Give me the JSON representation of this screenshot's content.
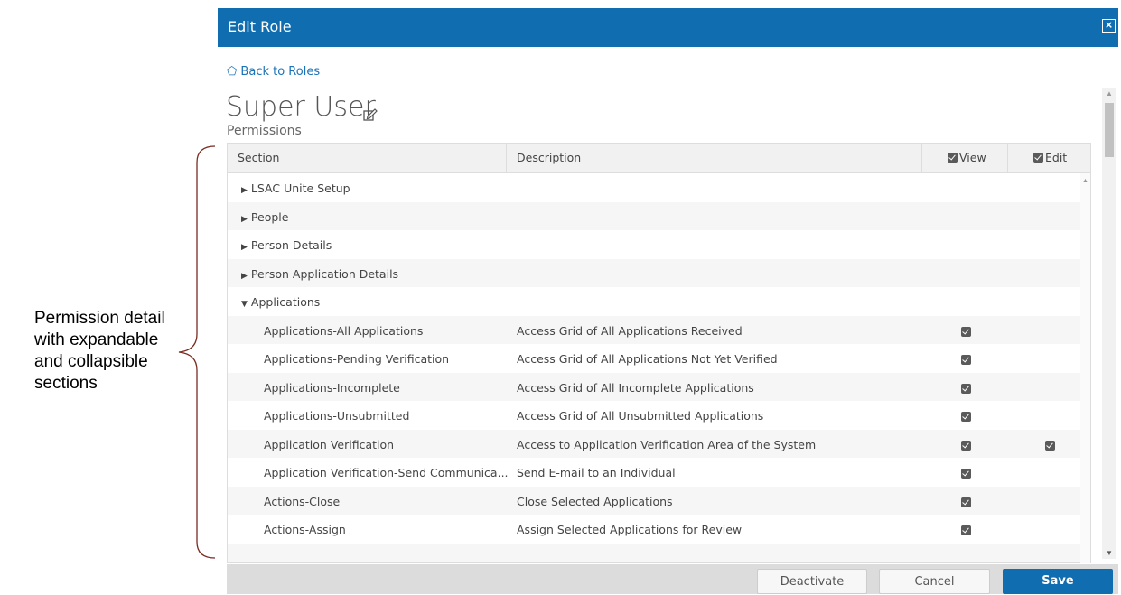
{
  "annotation": {
    "text": "Permission detail with expandable and collapsible sections"
  },
  "dialog": {
    "title": "Edit Role",
    "back_link": "⬠ Back to Roles",
    "role_name": "Super User",
    "permissions_label": "Permissions"
  },
  "grid": {
    "columns": {
      "section": "Section",
      "description": "Description",
      "view": "View",
      "edit": "Edit"
    },
    "rows": [
      {
        "section": "LSAC Unite Setup",
        "expander": "▶",
        "description": "",
        "view": false,
        "edit": false,
        "child": false
      },
      {
        "section": "People",
        "expander": "▶",
        "description": "",
        "view": false,
        "edit": false,
        "child": false
      },
      {
        "section": "Person Details",
        "expander": "▶",
        "description": "",
        "view": false,
        "edit": false,
        "child": false
      },
      {
        "section": "Person Application Details",
        "expander": "▶",
        "description": "",
        "view": false,
        "edit": false,
        "child": false
      },
      {
        "section": "Applications",
        "expander": "▼",
        "description": "",
        "view": false,
        "edit": false,
        "child": false
      },
      {
        "section": "Applications-All Applications",
        "expander": "",
        "description": "Access Grid of All Applications Received",
        "view": true,
        "edit": false,
        "child": true
      },
      {
        "section": "Applications-Pending Verification",
        "expander": "",
        "description": "Access Grid of All Applications Not Yet Verified",
        "view": true,
        "edit": false,
        "child": true
      },
      {
        "section": "Applications-Incomplete",
        "expander": "",
        "description": "Access Grid of All Incomplete Applications",
        "view": true,
        "edit": false,
        "child": true
      },
      {
        "section": "Applications-Unsubmitted",
        "expander": "",
        "description": "Access Grid of All Unsubmitted Applications",
        "view": true,
        "edit": false,
        "child": true
      },
      {
        "section": "Application Verification",
        "expander": "",
        "description": "Access to Application Verification Area of the System",
        "view": true,
        "edit": true,
        "child": true
      },
      {
        "section": "Application Verification-Send Communica...",
        "expander": "",
        "description": "Send E-mail to an Individual",
        "view": true,
        "edit": false,
        "child": true
      },
      {
        "section": "Actions-Close",
        "expander": "",
        "description": "Close Selected Applications",
        "view": true,
        "edit": false,
        "child": true
      },
      {
        "section": "Actions-Assign",
        "expander": "",
        "description": "Assign Selected Applications for Review",
        "view": true,
        "edit": false,
        "child": true
      }
    ]
  },
  "footer": {
    "deactivate_label": "Deactivate",
    "cancel_label": "Cancel",
    "save_label": "Save"
  },
  "colors": {
    "titlebar": "#0f6db0",
    "link": "#1a73b8",
    "save_button": "#0f6db0"
  }
}
